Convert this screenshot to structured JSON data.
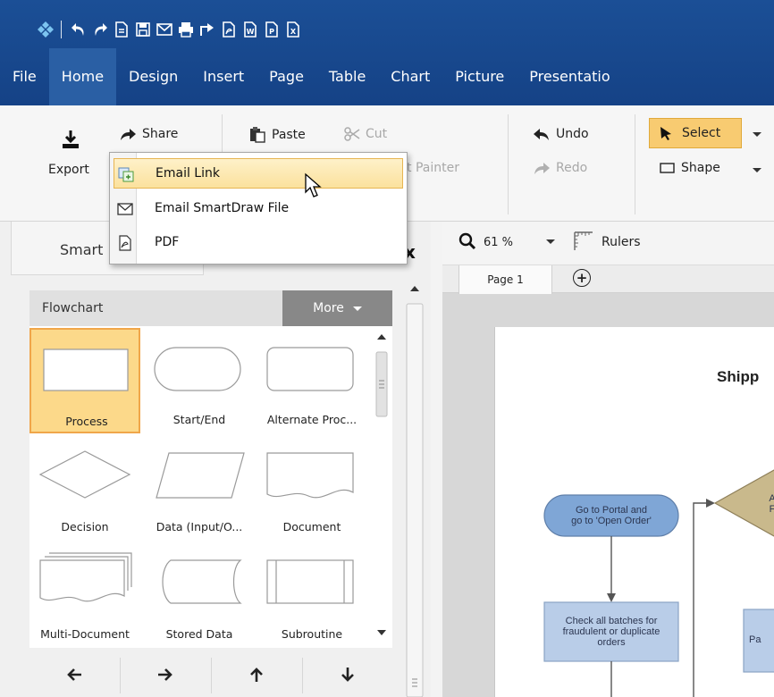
{
  "menubar": {
    "items": [
      "File",
      "Home",
      "Design",
      "Insert",
      "Page",
      "Table",
      "Chart",
      "Picture",
      "Presentatio"
    ]
  },
  "ribbon": {
    "export_label": "Export",
    "share_label": "Share",
    "paste_label": "Paste",
    "cut_label": "Cut",
    "format_painter_label": "t Painter",
    "undo_label": "Undo",
    "redo_label": "Redo",
    "select_label": "Select",
    "shape_label": "Shape"
  },
  "share_menu": {
    "items": [
      {
        "label": "Email Link",
        "icon": "email-link-icon"
      },
      {
        "label": "Email SmartDraw File",
        "icon": "envelope-icon"
      },
      {
        "label": "PDF",
        "icon": "pdf-icon"
      }
    ]
  },
  "left_panel": {
    "tab_label": "Smart",
    "close_glyph": "x",
    "library": {
      "title": "Flowchart",
      "more_label": "More",
      "shapes": [
        "Process",
        "Start/End",
        "Alternate Proc...",
        "Decision",
        "Data (Input/O...",
        "Document",
        "Multi-Document",
        "Stored Data",
        "Subroutine"
      ],
      "selected": "Process"
    },
    "nav_icons": [
      "arrow-left-icon",
      "arrow-right-icon",
      "arrow-up-icon",
      "arrow-down-icon"
    ]
  },
  "canvas": {
    "zoom_label": "61 %",
    "rulers_label": "Rulers",
    "page_tab": "Page 1",
    "add_page_glyph": "+",
    "title": "Shipp",
    "nodes": {
      "start_line1": "Go to Portal and",
      "start_line2": "go to 'Open Order'",
      "process_line1": "Check all batches for",
      "process_line2": "fraudulent or duplicate",
      "process_line3": "orders",
      "decision_line1": "A",
      "decision_line2": "F",
      "right_box": "Pa"
    }
  },
  "colors": {
    "header_blue": "#1b4f96",
    "select_highlight": "#f8cb71",
    "start_node": "#7fa6d6",
    "process_node": "#b9cde8",
    "decision_node": "#c9b98c"
  }
}
